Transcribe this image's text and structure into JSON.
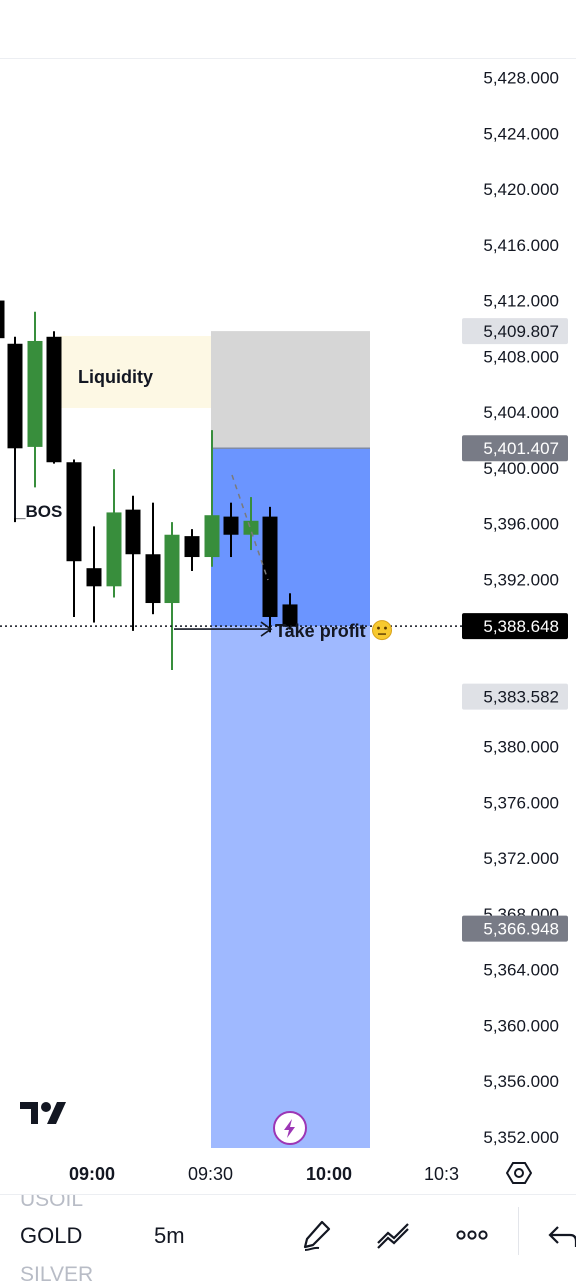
{
  "chart_data": {
    "type": "candlestick",
    "instrument": "GOLD",
    "timeframe": "5m",
    "y_ticks": [
      5428,
      5424,
      5420,
      5416,
      5412,
      5408,
      5404,
      5400,
      5396,
      5392,
      5388,
      5384,
      5380,
      5376,
      5372,
      5368,
      5364,
      5360,
      5356,
      5352
    ],
    "y_tick_labels": [
      "5,428.000",
      "5,424.000",
      "5,420.000",
      "5,416.000",
      "5,412.000",
      "5,408.000",
      "5,404.000",
      "5,400.000",
      "5,396.000",
      "5,392.000",
      "",
      "",
      "5,380.000",
      "5,376.000",
      "5,372.000",
      "5,368.000",
      "5,364.000",
      "5,360.000",
      "5,356.000",
      "5,352.000"
    ],
    "x_ticks": [
      "09:00",
      "09:30",
      "10:00",
      "10:3"
    ],
    "candles": [
      {
        "o": 5412.0,
        "h": 5413.6,
        "l": 5408.8,
        "c": 5409.3
      },
      {
        "o": 5408.9,
        "h": 5409.4,
        "l": 5396.1,
        "c": 5401.4
      },
      {
        "o": 5401.5,
        "h": 5411.2,
        "l": 5398.6,
        "c": 5409.1
      },
      {
        "o": 5409.4,
        "h": 5409.8,
        "l": 5400.3,
        "c": 5400.4
      },
      {
        "o": 5400.4,
        "h": 5400.6,
        "l": 5389.3,
        "c": 5393.3
      },
      {
        "o": 5392.8,
        "h": 5395.8,
        "l": 5388.9,
        "c": 5391.5
      },
      {
        "o": 5391.5,
        "h": 5399.9,
        "l": 5390.7,
        "c": 5396.8
      },
      {
        "o": 5397.0,
        "h": 5398.0,
        "l": 5388.3,
        "c": 5393.8
      },
      {
        "o": 5393.8,
        "h": 5397.5,
        "l": 5389.5,
        "c": 5390.3
      },
      {
        "o": 5390.3,
        "h": 5396.1,
        "l": 5385.5,
        "c": 5395.2
      },
      {
        "o": 5395.1,
        "h": 5395.6,
        "l": 5392.6,
        "c": 5393.6
      },
      {
        "o": 5393.6,
        "h": 5402.7,
        "l": 5392.9,
        "c": 5396.6
      },
      {
        "o": 5396.5,
        "h": 5397.5,
        "l": 5393.6,
        "c": 5395.2
      },
      {
        "o": 5395.2,
        "h": 5397.9,
        "l": 5394.1,
        "c": 5396.2
      },
      {
        "o": 5396.5,
        "h": 5397.2,
        "l": 5388.2,
        "c": 5389.3
      },
      {
        "o": 5390.2,
        "h": 5391.0,
        "l": 5388.4,
        "c": 5388.6
      }
    ],
    "price_tags": [
      {
        "value": 5409.807,
        "label": "5,409.807",
        "bg": "#dfe1e6",
        "fg": "#131722"
      },
      {
        "value": 5401.407,
        "label": "5,401.407",
        "bg": "#787b86",
        "fg": "#ffffff"
      },
      {
        "value": 5388.648,
        "label": "5,388.648",
        "bg": "#000000",
        "fg": "#ffffff"
      },
      {
        "value": 5383.582,
        "label": "5,383.582",
        "bg": "#dfe1e6",
        "fg": "#131722"
      },
      {
        "value": 5366.948,
        "label": "5,366.948",
        "bg": "#787b86",
        "fg": "#ffffff"
      }
    ],
    "current_price": 5388.648,
    "position_tool": {
      "entry": 5401.407,
      "stop": 5409.807,
      "target": 5352.0
    },
    "annotations": {
      "liquidity_label": "Liquidity",
      "bos_label": "_BOS",
      "take_profit_label": "Take profit",
      "take_profit_emoji": "🫡"
    },
    "colors": {
      "bull": "#388e3c",
      "bear": "#000000",
      "liquidity_zone": "#fdf8e4",
      "stop_zone": "#d6d6d6",
      "target_zone_dark": "#6b95ff",
      "target_zone_light": "#9fb9ff",
      "badge": "#9c36b5"
    }
  },
  "symbols": {
    "prev": "USOIL",
    "current": "GOLD",
    "next": "SILVER"
  },
  "toolbar": {
    "timeframe": "5m",
    "icons": [
      "pencil-icon",
      "trend-line-icon",
      "more-dots-icon",
      "undo-icon",
      "settings-icon",
      "tradingview-logo",
      "lightning-icon"
    ]
  }
}
